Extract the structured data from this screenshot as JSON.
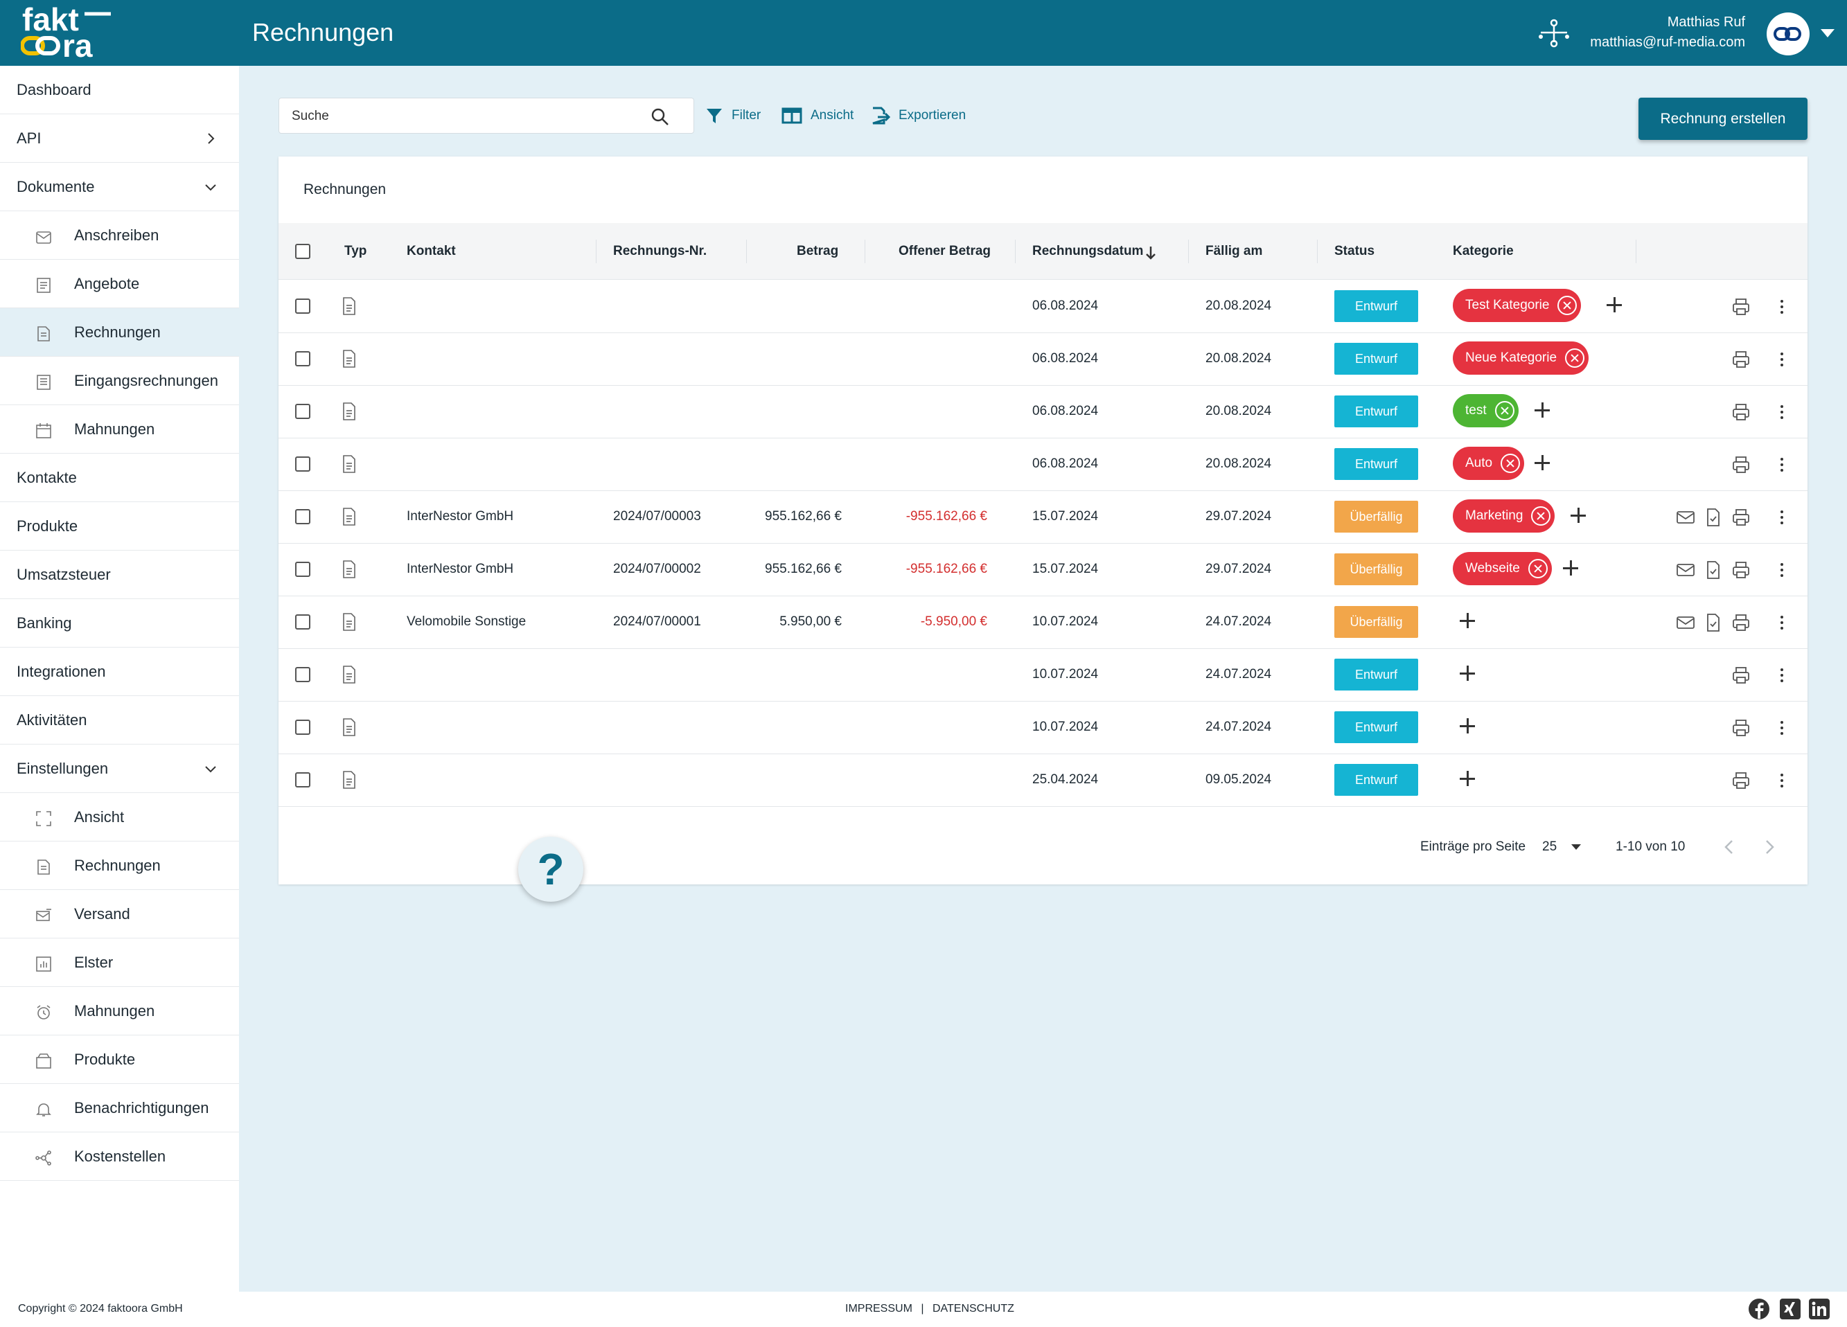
{
  "header": {
    "logo_text": "faktoora",
    "title": "Rechnungen",
    "user_name": "Matthias Ruf",
    "user_email": "matthias@ruf-media.com"
  },
  "sidebar": {
    "items": [
      {
        "label": "Dashboard",
        "level": 0
      },
      {
        "label": "API",
        "level": 0,
        "chevron": "right"
      },
      {
        "label": "Dokumente",
        "level": 0,
        "chevron": "down"
      },
      {
        "label": "Anschreiben",
        "level": 1,
        "icon": "letter-icon"
      },
      {
        "label": "Angebote",
        "level": 1,
        "icon": "offer-icon"
      },
      {
        "label": "Rechnungen",
        "level": 1,
        "icon": "invoice-icon",
        "active": true
      },
      {
        "label": "Eingangsrechnungen",
        "level": 1,
        "icon": "incoming-invoice-icon"
      },
      {
        "label": "Mahnungen",
        "level": 1,
        "icon": "calendar-icon"
      },
      {
        "label": "Kontakte",
        "level": 0
      },
      {
        "label": "Produkte",
        "level": 0
      },
      {
        "label": "Umsatzsteuer",
        "level": 0
      },
      {
        "label": "Banking",
        "level": 0
      },
      {
        "label": "Integrationen",
        "level": 0
      },
      {
        "label": "Aktivitäten",
        "level": 0
      },
      {
        "label": "Einstellungen",
        "level": 0,
        "chevron": "down"
      },
      {
        "label": "Ansicht",
        "level": 1,
        "icon": "frame-icon"
      },
      {
        "label": "Rechnungen",
        "level": 1,
        "icon": "invoice-icon"
      },
      {
        "label": "Versand",
        "level": 1,
        "icon": "shipping-icon"
      },
      {
        "label": "Elster",
        "level": 1,
        "icon": "chart-icon"
      },
      {
        "label": "Mahnungen",
        "level": 1,
        "icon": "alarm-icon"
      },
      {
        "label": "Produkte",
        "level": 1,
        "icon": "box-icon"
      },
      {
        "label": "Benachrichtigungen",
        "level": 1,
        "icon": "bell-icon"
      },
      {
        "label": "Kostenstellen",
        "level": 1,
        "icon": "network-icon"
      }
    ]
  },
  "toolbar": {
    "search_placeholder": "Suche",
    "filter_label": "Filter",
    "view_label": "Ansicht",
    "export_label": "Exportieren",
    "create_label": "Rechnung erstellen"
  },
  "table": {
    "title": "Rechnungen",
    "columns": {
      "type": "Typ",
      "contact": "Kontakt",
      "number": "Rechnungs-Nr.",
      "amount": "Betrag",
      "open": "Offener Betrag",
      "date": "Rechnungsdatum",
      "due": "Fällig am",
      "status": "Status",
      "category": "Kategorie"
    },
    "rows": [
      {
        "contact": "",
        "number": "",
        "amount": "",
        "open": "",
        "date": "06.08.2024",
        "due": "20.08.2024",
        "status": "Entwurf",
        "status_kind": "draft",
        "category": "Test Kategorie",
        "category_color": "#e53340",
        "more_chip": false,
        "send": false
      },
      {
        "contact": "",
        "number": "",
        "amount": "",
        "open": "",
        "date": "06.08.2024",
        "due": "20.08.2024",
        "status": "Entwurf",
        "status_kind": "draft",
        "category": "Neue Kategorie",
        "category_color": "#e53340",
        "more_chip": true,
        "send": false
      },
      {
        "contact": "",
        "number": "",
        "amount": "",
        "open": "",
        "date": "06.08.2024",
        "due": "20.08.2024",
        "status": "Entwurf",
        "status_kind": "draft",
        "category": "test",
        "category_color": "#4db533",
        "more_chip": false,
        "send": false
      },
      {
        "contact": "",
        "number": "",
        "amount": "",
        "open": "",
        "date": "06.08.2024",
        "due": "20.08.2024",
        "status": "Entwurf",
        "status_kind": "draft",
        "category": "Auto",
        "category_color": "#e53340",
        "more_chip": false,
        "send": false
      },
      {
        "contact": "InterNestor GmbH",
        "number": "2024/07/00003",
        "amount": "955.162,66 €",
        "open": "-955.162,66 €",
        "date": "15.07.2024",
        "due": "29.07.2024",
        "status": "Überfällig",
        "status_kind": "overdue",
        "category": "Marketing",
        "category_color": "#e53340",
        "more_chip": false,
        "send": true
      },
      {
        "contact": "InterNestor GmbH",
        "number": "2024/07/00002",
        "amount": "955.162,66 €",
        "open": "-955.162,66 €",
        "date": "15.07.2024",
        "due": "29.07.2024",
        "status": "Überfällig",
        "status_kind": "overdue",
        "category": "Webseite",
        "category_color": "#e53340",
        "more_chip": false,
        "send": true
      },
      {
        "contact": "Velomobile Sonstige",
        "number": "2024/07/00001",
        "amount": "5.950,00 €",
        "open": "-5.950,00 €",
        "date": "10.07.2024",
        "due": "24.07.2024",
        "status": "Überfällig",
        "status_kind": "overdue",
        "category": "",
        "category_color": "",
        "more_chip": false,
        "send": true
      },
      {
        "contact": "",
        "number": "",
        "amount": "",
        "open": "",
        "date": "10.07.2024",
        "due": "24.07.2024",
        "status": "Entwurf",
        "status_kind": "draft",
        "category": "",
        "category_color": "",
        "more_chip": false,
        "send": false
      },
      {
        "contact": "",
        "number": "",
        "amount": "",
        "open": "",
        "date": "10.07.2024",
        "due": "24.07.2024",
        "status": "Entwurf",
        "status_kind": "draft",
        "category": "",
        "category_color": "",
        "more_chip": false,
        "send": false
      },
      {
        "contact": "",
        "number": "",
        "amount": "",
        "open": "",
        "date": "25.04.2024",
        "due": "09.05.2024",
        "status": "Entwurf",
        "status_kind": "draft",
        "category": "",
        "category_color": "",
        "more_chip": false,
        "send": false
      }
    ]
  },
  "pagination": {
    "per_page_label": "Einträge pro Seite",
    "per_page_value": "25",
    "range": "1-10 von 10"
  },
  "help": {
    "label": "?"
  },
  "footer": {
    "copyright": "Copyright © 2024 faktoora GmbH",
    "impressum": "IMPRESSUM",
    "separator": "|",
    "datenschutz": "DATENSCHUTZ"
  },
  "colors": {
    "brand": "#0b6c88",
    "draft": "#15b4d3",
    "overdue": "#f2a64a",
    "negative": "#d32f2f"
  }
}
